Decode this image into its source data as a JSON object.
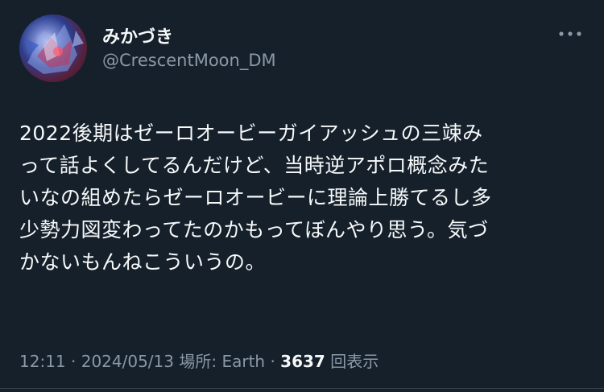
{
  "author": {
    "display_name": "みかづき",
    "handle": "@CrescentMoon_DM"
  },
  "tweet": {
    "lines": [
      "2022後期はゼーロオービーガイアッシュの三竦み",
      "って話よくしてるんだけど、当時逆アポロ概念みた",
      "いなの組めたらゼーロオービーに理論上勝てるし多",
      "少勢力図変わってたのかもってぼんやり思う。気づ",
      "かないもんねこういうの。"
    ]
  },
  "meta": {
    "time": "12:11",
    "date": "2024/05/13",
    "location_label": "場所: Earth",
    "views_count": "3637",
    "views_label": "回表示",
    "separator": "·"
  },
  "icons": {
    "more": "more-horizontal-icon",
    "avatar": "avatar-image"
  },
  "colors": {
    "background": "#15202b",
    "primary_text": "#f7f9f9",
    "secondary_text": "#8b98a5"
  }
}
